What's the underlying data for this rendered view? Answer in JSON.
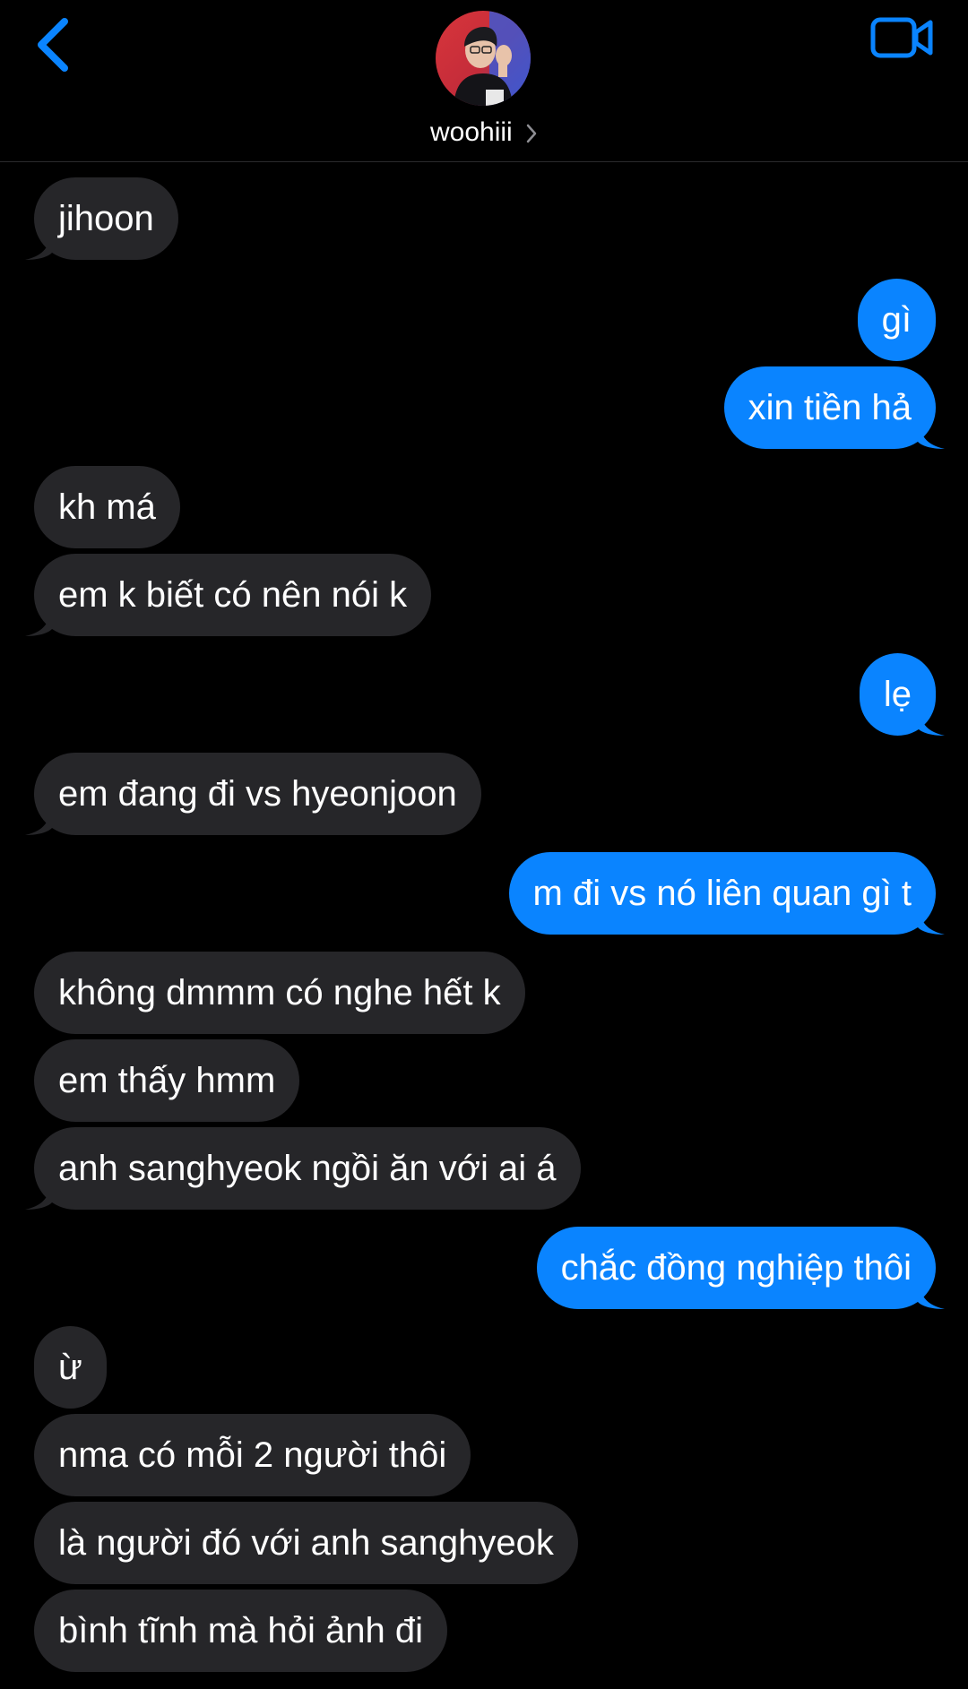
{
  "header": {
    "contact_name": "woohiii",
    "back_icon": "chevron-left-icon",
    "video_icon": "video-camera-icon",
    "accent_color": "#0a84ff"
  },
  "colors": {
    "incoming_bubble": "#262629",
    "outgoing_bubble": "#0a84ff",
    "background": "#000000"
  },
  "messages": [
    {
      "direction": "in",
      "text": "jihoon",
      "tail": true
    },
    {
      "direction": "out",
      "text": "gì",
      "tail": false
    },
    {
      "direction": "out",
      "text": "xin tiền hả",
      "tail": true
    },
    {
      "direction": "in",
      "text": "kh má",
      "tail": false
    },
    {
      "direction": "in",
      "text": "em k biết có nên nói k",
      "tail": true
    },
    {
      "direction": "out",
      "text": "lẹ",
      "tail": true
    },
    {
      "direction": "in",
      "text": "em đang đi vs hyeonjoon",
      "tail": true
    },
    {
      "direction": "out",
      "text": "m đi vs nó liên quan gì t",
      "tail": true
    },
    {
      "direction": "in",
      "text": "không dmmm có nghe hết k",
      "tail": false
    },
    {
      "direction": "in",
      "text": "em thấy hmm",
      "tail": false
    },
    {
      "direction": "in",
      "text": "anh sanghyeok ngồi ăn với ai á",
      "tail": true
    },
    {
      "direction": "out",
      "text": "chắc đồng nghiệp thôi",
      "tail": true
    },
    {
      "direction": "in",
      "text": "ừ",
      "tail": false
    },
    {
      "direction": "in",
      "text": "nma có mỗi 2 người thôi",
      "tail": false
    },
    {
      "direction": "in",
      "text": "là người đó với anh sanghyeok",
      "tail": false
    },
    {
      "direction": "in",
      "text": "bình tĩnh mà hỏi ảnh đi",
      "tail": false
    }
  ]
}
